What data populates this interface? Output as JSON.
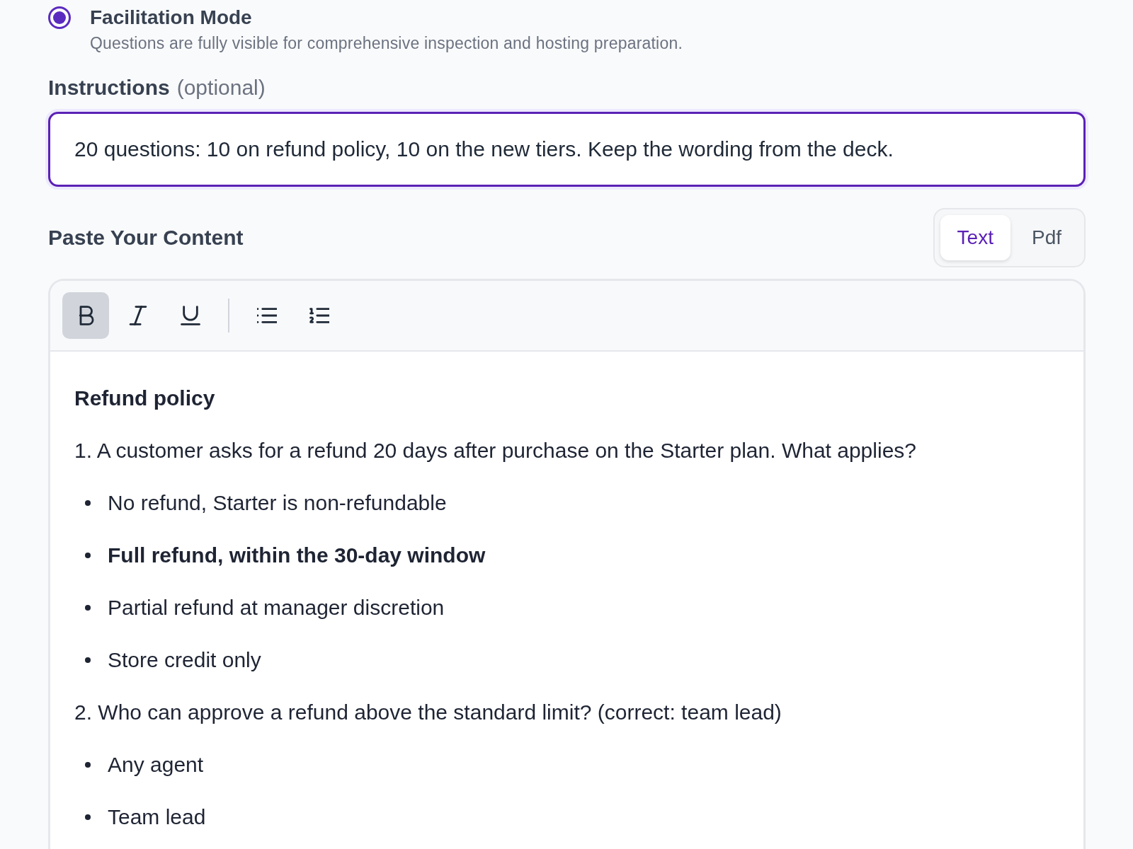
{
  "mode_option": {
    "title": "Facilitation Mode",
    "description": "Questions are fully visible for comprehensive inspection and hosting preparation.",
    "selected": true
  },
  "instructions": {
    "label": "Instructions",
    "note": "(optional)",
    "value": "20 questions: 10 on refund policy, 10 on the new tiers. Keep the wording from the deck.",
    "focused": true
  },
  "content": {
    "title": "Paste Your Content",
    "tabs": [
      {
        "label": "Text",
        "selected": true
      },
      {
        "label": "Pdf",
        "selected": false
      }
    ],
    "toolbar": [
      {
        "kind": "bold",
        "active": true
      },
      {
        "kind": "italic",
        "active": false
      },
      {
        "kind": "underline",
        "active": false
      },
      {
        "kind": "divider"
      },
      {
        "kind": "bullet_list",
        "active": false
      },
      {
        "kind": "ordered_list",
        "active": false
      }
    ],
    "editor": [
      {
        "kind": "heading",
        "text": "Refund policy"
      },
      {
        "kind": "paragraph",
        "text": "1. A customer asks for a refund 20 days after purchase on the Starter plan. What applies?"
      },
      {
        "kind": "bullet",
        "text": "No refund, Starter is non-refundable",
        "bold": false
      },
      {
        "kind": "bullet",
        "text": "Full refund, within the 30-day window",
        "bold": true
      },
      {
        "kind": "bullet",
        "text": "Partial refund at manager discretion",
        "bold": false
      },
      {
        "kind": "bullet",
        "text": "Store credit only",
        "bold": false
      },
      {
        "kind": "paragraph",
        "text": "2. Who can approve a refund above the standard limit? (correct: team lead)"
      },
      {
        "kind": "bullet",
        "text": "Any agent",
        "bold": false
      },
      {
        "kind": "bullet",
        "text": "Team lead",
        "bold": false
      }
    ]
  }
}
